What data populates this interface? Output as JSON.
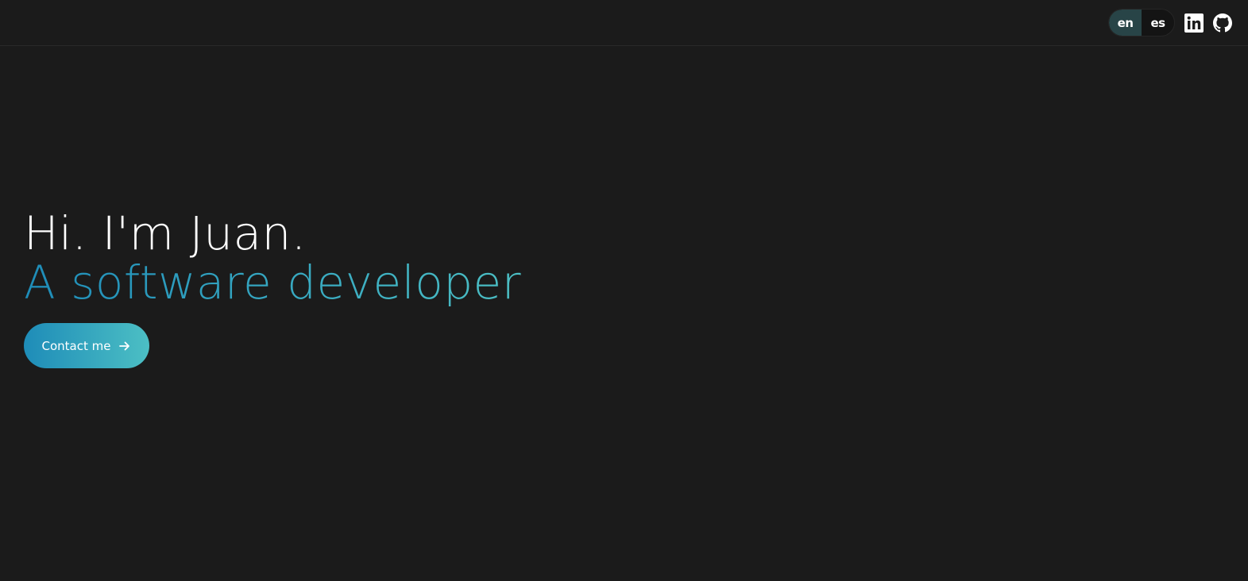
{
  "header": {
    "languages": [
      {
        "label": "en",
        "active": true
      },
      {
        "label": "es",
        "active": false
      }
    ],
    "social": [
      {
        "icon": "linkedin-icon"
      },
      {
        "icon": "github-icon"
      }
    ]
  },
  "hero": {
    "greeting": "Hi. I'm Juan.",
    "role": "A software developer",
    "cta_label": "Contact me",
    "cta_icon": "arrow-right-icon"
  },
  "colors": {
    "background": "#1b1b1b",
    "gradient_start": "#1e8cb8",
    "gradient_end": "#4cbfc4",
    "active_lang": "#284447"
  }
}
